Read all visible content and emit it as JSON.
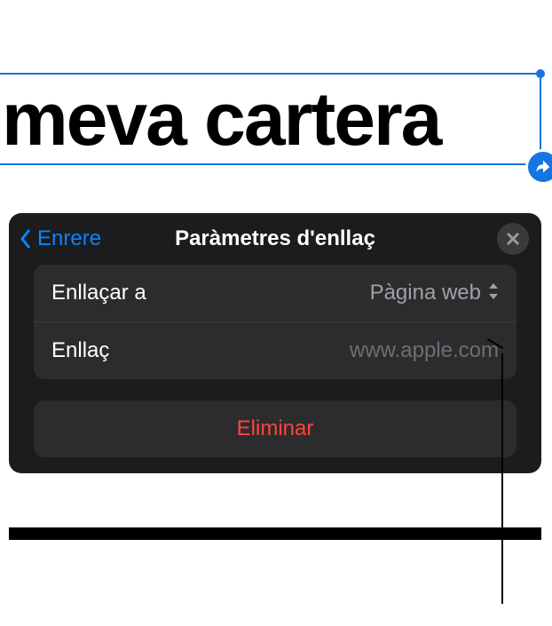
{
  "canvas": {
    "selected_text": "meva cartera"
  },
  "popover": {
    "back_label": "Enrere",
    "title": "Paràmetres d'enllaç",
    "rows": {
      "link_to": {
        "label": "Enllaçar a",
        "value": "Pàgina web"
      },
      "link": {
        "label": "Enllaç",
        "placeholder": "www.apple.com",
        "value": ""
      }
    },
    "delete_label": "Eliminar"
  }
}
